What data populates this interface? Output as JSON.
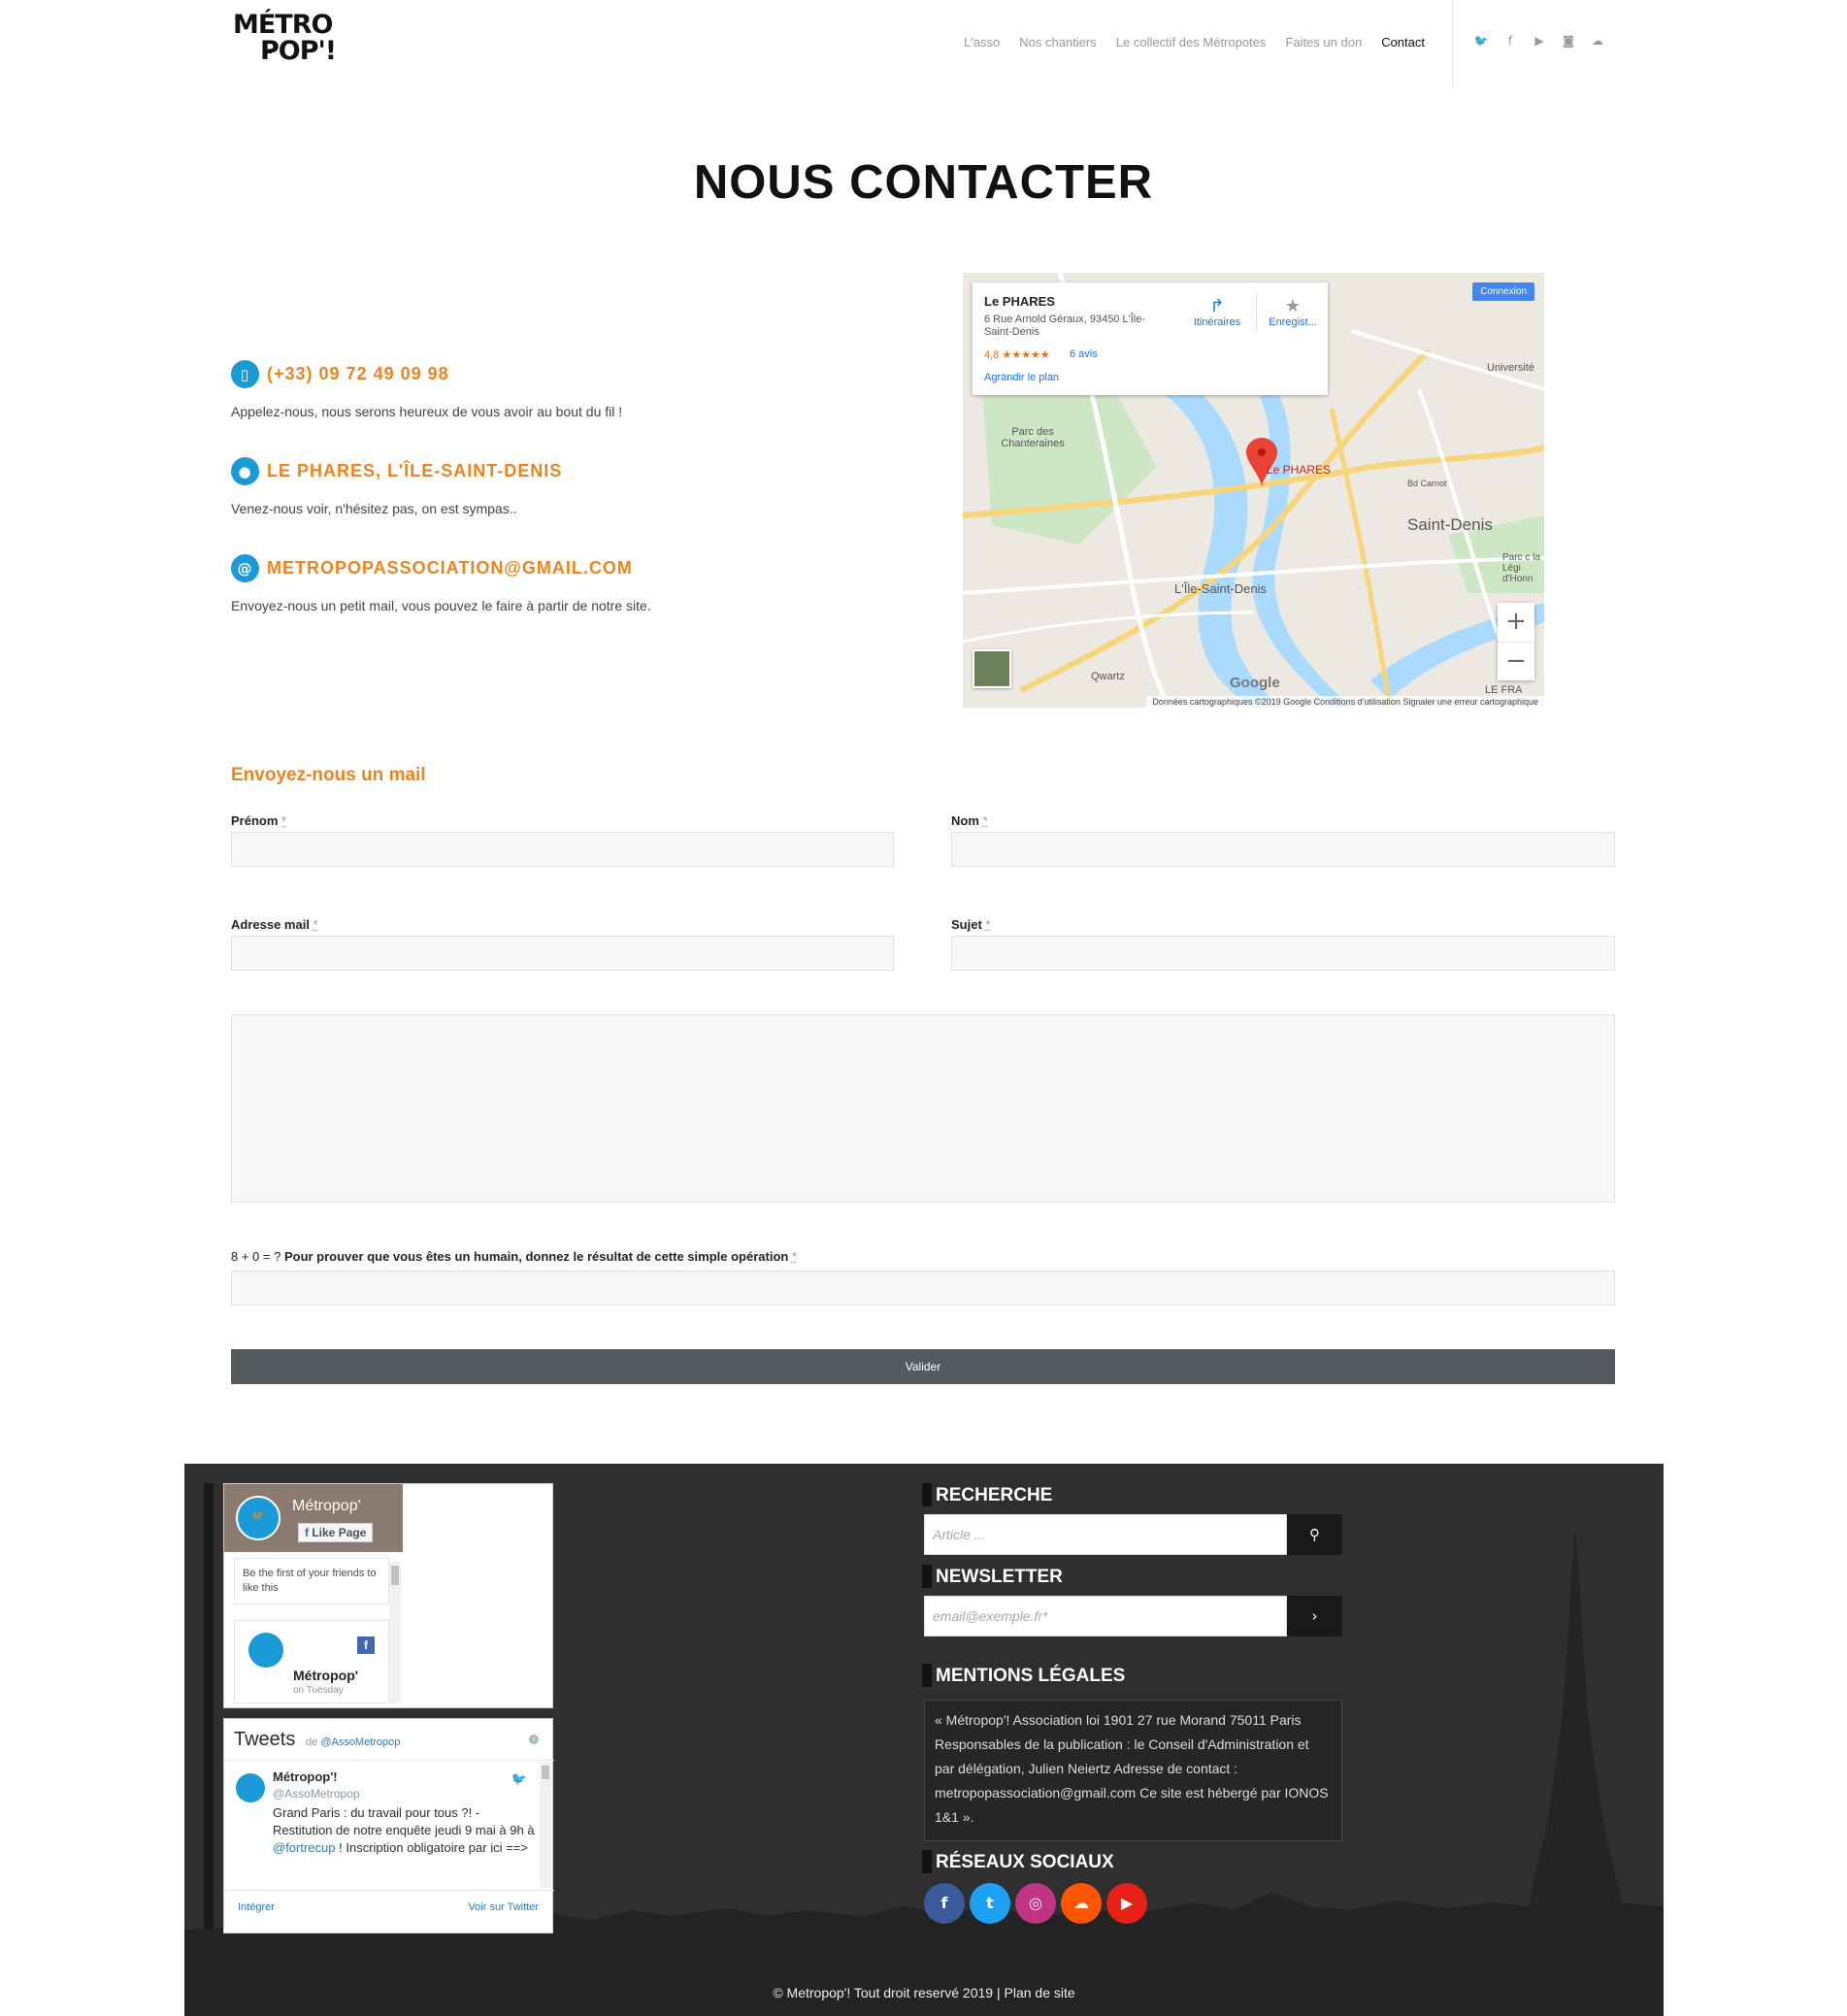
{
  "header": {
    "logo_top": "MÉTRO",
    "logo_bottom": "POP'!",
    "nav": [
      "L'asso",
      "Nos chantiers",
      "Le collectif des Métropotes",
      "Faites un don",
      "Contact"
    ],
    "social_icons": [
      "twitter-icon",
      "facebook-icon",
      "youtube-icon",
      "instagram-icon",
      "soundcloud-icon"
    ]
  },
  "page_title": "NOUS CONTACTER",
  "contact": {
    "phone": {
      "title": "(+33) 09 72 49 09 98",
      "text": "Appelez-nous, nous serons heureux de vous avoir au bout du fil !"
    },
    "place": {
      "title": "LE PHARES, L'ÎLE-SAINT-DENIS",
      "text": "Venez-nous voir, n'hésitez pas, on est sympas.."
    },
    "mail": {
      "title": "METROPOPASSOCIATION@GMAIL.COM",
      "text": "Envoyez-nous un petit mail, vous pouvez le faire à partir de notre site."
    }
  },
  "map": {
    "place_name": "Le PHARES",
    "address": "6 Rue Arnold Géraux, 93450 L'Île-Saint-Denis",
    "rating": "4,8 ★★★★★",
    "reviews": "6 avis",
    "enlarge": "Agrandir le plan",
    "directions": "Itinéraires",
    "save": "Enregist...",
    "connect": "Connexion",
    "pin_label": "Le PHARES",
    "labels": {
      "parc": "Parc des Chanteraines",
      "saint_denis": "Saint-Denis",
      "ile": "L'Île-Saint-Denis",
      "universite": "Université",
      "qwartz": "Qwartz",
      "bd_carnot": "Bd Carnot",
      "parc2": "Parc c la Légi d'Honn",
      "le_fra": "LE FRA"
    },
    "google": "Google",
    "footer": "Données cartographiques ©2019 Google   Conditions d'utilisation   Signaler une erreur cartographique"
  },
  "form": {
    "title": "Envoyez-nous un mail",
    "prenom": "Prénom",
    "nom": "Nom",
    "email": "Adresse mail",
    "sujet": "Sujet",
    "required_mark": "*",
    "captcha_prefix": "8 + 0 = ?",
    "captcha_label": "Pour prouver que vous êtes un humain, donnez le résultat de cette simple opération",
    "submit": "Valider"
  },
  "footer": {
    "fb": {
      "page_name": "Métropop'",
      "like": "Like Page",
      "first": "Be the first of your friends to like this",
      "post_name": "Métropop'",
      "post_when": "on Tuesday"
    },
    "tw": {
      "title": "Tweets",
      "by": "de",
      "handle_link": "@AssoMetropop",
      "name": "Métropop'!",
      "handle": "@AssoMetropop",
      "text1": "Grand Paris : du travail pour tous ?! - Restitution de notre enquête jeudi 9 mai à 9h à",
      "mention": "@fortrecup",
      "text2": "! Inscription obligatoire par ici ==>",
      "embed": "Intégrer",
      "view": "Voir sur Twitter"
    },
    "search_title": "RECHERCHE",
    "search_placeholder": "Article ...",
    "newsletter_title": "NEWSLETTER",
    "newsletter_placeholder": "email@exemple.fr*",
    "legal_title": "MENTIONS LÉGALES",
    "legal_text": "« Métropop'! Association loi 1901 27 rue Morand 75011 Paris Responsables de la publication : le Conseil d'Administration et par délégation, Julien Neiertz Adresse de contact : metropopassociation@gmail.com Ce site est hébergé par IONOS 1&1 ».",
    "social_title": "RÉSEAUX SOCIAUX",
    "social": [
      {
        "name": "facebook",
        "glyph": "f",
        "color": "#3b5998"
      },
      {
        "name": "twitter",
        "glyph": "t",
        "color": "#1da1f2"
      },
      {
        "name": "instagram",
        "glyph": "◎",
        "color": "#c13584"
      },
      {
        "name": "soundcloud",
        "glyph": "☁",
        "color": "#ff5500"
      },
      {
        "name": "youtube",
        "glyph": "▶",
        "color": "#e62117"
      }
    ],
    "copyright": "© Metropop'! Tout droit reservé 2019 |",
    "sitemap": "Plan de site"
  },
  "colors": {
    "accent": "#e8851f",
    "icon_blue": "#1a9bd7",
    "footer_bg": "#2f2f2f",
    "button": "#555a5f"
  }
}
